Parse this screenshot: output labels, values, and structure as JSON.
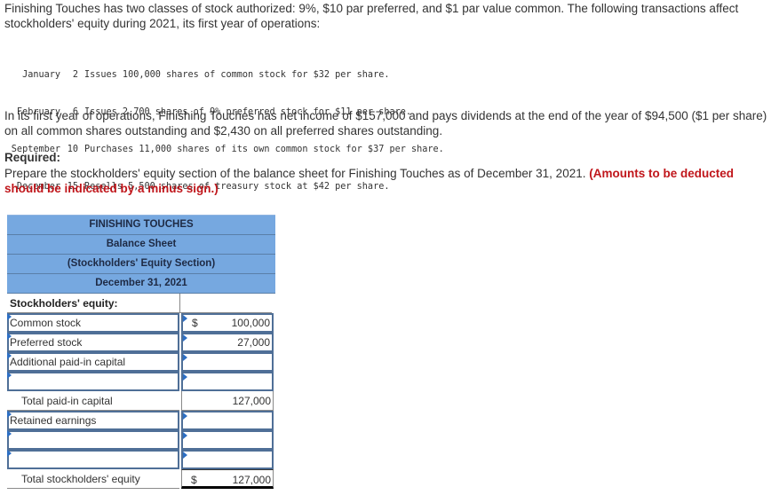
{
  "intro": "Finishing Touches has two classes of stock authorized: 9%, $10 par preferred, and $1 par value common. The following transactions affect stockholders' equity during 2021, its first year of operations:",
  "transactions": [
    {
      "month": "January",
      "day": "2",
      "text": "Issues 100,000 shares of common stock for $32 per share."
    },
    {
      "month": "February",
      "day": "6",
      "text": "Issues 2,700 shares of 9% preferred stock for $11 per share."
    },
    {
      "month": "September",
      "day": "10",
      "text": "Purchases 11,000 shares of its own common stock for $37 per share."
    },
    {
      "month": "December",
      "day": "15",
      "text": "Resells 5,500 shares of treasury stock at $42 per share."
    }
  ],
  "income_para": "In its first year of operations, Finishing Touches has net income of $157,000 and pays dividends at the end of the year of $94,500 ($1 per share) on all common shares outstanding and $2,430 on all preferred shares outstanding.",
  "required": {
    "heading": "Required:",
    "body": "Prepare the stockholders' equity section of the balance sheet for Finishing Touches as of December 31, 2021.",
    "note": "(Amounts to be deducted should be indicated by a minus sign.)"
  },
  "sheet": {
    "headers": [
      "FINISHING TOUCHES",
      "Balance Sheet",
      "(Stockholders' Equity Section)",
      "December 31, 2021"
    ],
    "section_label": "Stockholders' equity:",
    "currency": "$",
    "rows": [
      {
        "label": "Common stock",
        "value": "100,000",
        "dollar": true
      },
      {
        "label": "Preferred stock",
        "value": "27,000",
        "dollar": false
      },
      {
        "label": "Additional paid-in capital",
        "value": "",
        "dollar": false
      },
      {
        "label": "",
        "value": "",
        "dollar": false
      }
    ],
    "total_paid_in": {
      "label": "Total paid-in capital",
      "value": "127,000"
    },
    "rows2": [
      {
        "label": "Retained earnings",
        "value": ""
      },
      {
        "label": "",
        "value": ""
      },
      {
        "label": "",
        "value": ""
      }
    ],
    "grand_total": {
      "label": "Total stockholders' equity",
      "value": "127,000"
    }
  },
  "colors": {
    "header_bg": "#76a8e0",
    "input_border": "#4f6f97",
    "note_red": "#c0161b"
  }
}
